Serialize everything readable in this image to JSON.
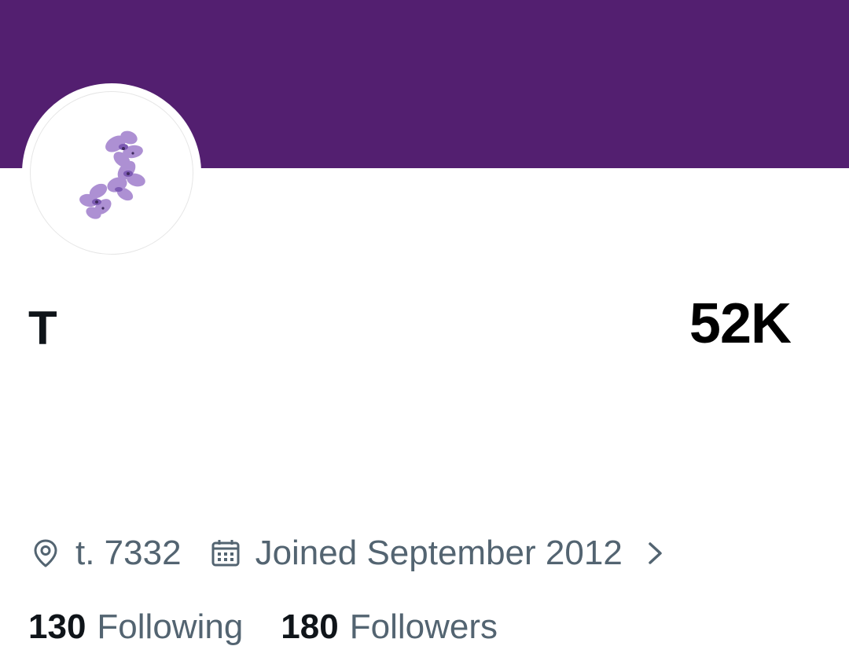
{
  "profile": {
    "banner_color": "#531f70",
    "avatar_icon": "lilac-flower-icon",
    "display_name": "T",
    "stat_value": "52K",
    "location": "t. 7332",
    "location_icon": "location-pin-icon",
    "joined": "Joined September 2012",
    "joined_icon": "calendar-icon",
    "chevron_icon": "chevron-right-icon",
    "following_count": "130",
    "following_label": "Following",
    "followers_count": "180",
    "followers_label": "Followers",
    "text_color": "#0f1419",
    "muted_color": "#536471"
  }
}
